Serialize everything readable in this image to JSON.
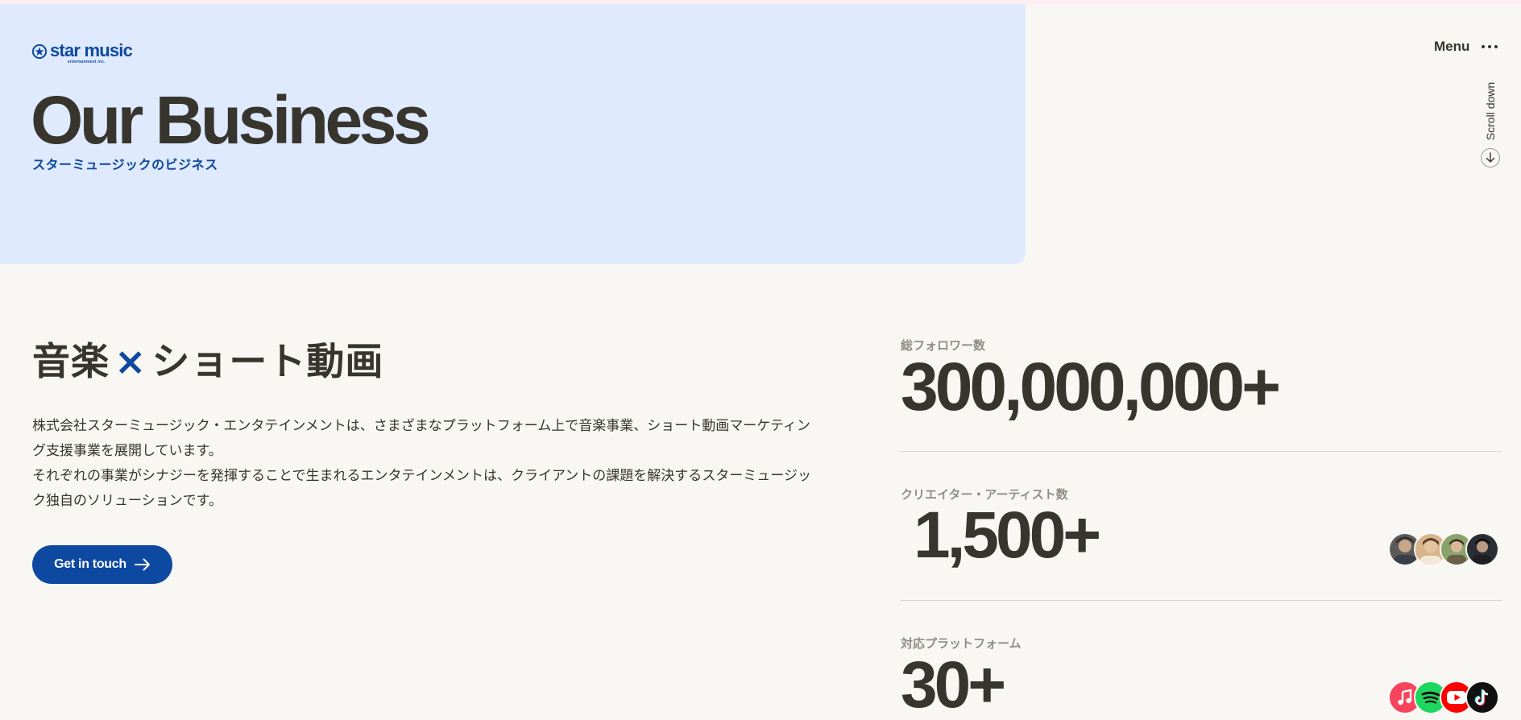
{
  "brand": {
    "name": "star music",
    "sub": "entertainment inc."
  },
  "hero": {
    "title": "Our Business",
    "subtitle": "スターミュージックのビジネス"
  },
  "nav": {
    "menu_label": "Menu",
    "scroll_label": "Scroll down"
  },
  "intro": {
    "heading_left": "音楽",
    "heading_x": "×",
    "heading_right": "ショート動画",
    "paragraph_1": "株式会社スターミュージック・エンタテインメントは、さまざまなプラットフォーム上で音楽事業、ショート動画マーケティング支援事業を展開しています。",
    "paragraph_2": "それぞれの事業がシナジーを発揮することで生まれるエンタテインメントは、クライアントの課題を解決するスターミュージック独自のソリューションです。",
    "cta_label": "Get in touch"
  },
  "stats": [
    {
      "label": "総フォロワー数",
      "value": "300,000,000+"
    },
    {
      "label": "クリエイター・アーティスト数",
      "value": "1,500+"
    },
    {
      "label": "対応プラットフォーム",
      "value": "30+"
    }
  ],
  "platform_icons": [
    "apple-music-icon",
    "spotify-icon",
    "youtube-icon",
    "tiktok-icon"
  ],
  "colors": {
    "accent": "#0d48a1",
    "hero_bg": "#dfeafe",
    "page_bg": "#f8f7f4",
    "text": "#37352d"
  }
}
